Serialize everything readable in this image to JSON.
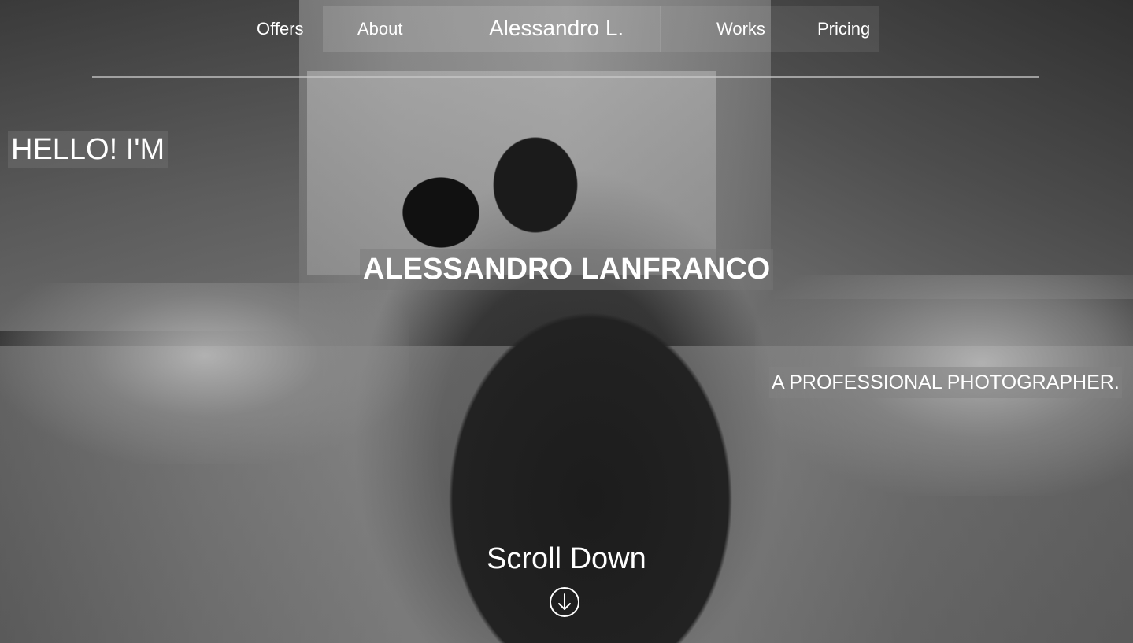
{
  "nav": {
    "links": {
      "offers": "Offers",
      "about": "About",
      "works": "Works",
      "pricing": "Pricing"
    },
    "brand": "Alessandro L."
  },
  "hero": {
    "greeting": "HELLO! I'M",
    "name": "ALESSANDRO LANFRANCO",
    "tagline": "A PROFESSIONAL PHOTOGRAPHER.",
    "scroll_label": "Scroll Down",
    "scroll_icon": "arrow-down-circle-icon"
  },
  "colors": {
    "text": "#ffffff",
    "divider": "#c8c8c8"
  }
}
